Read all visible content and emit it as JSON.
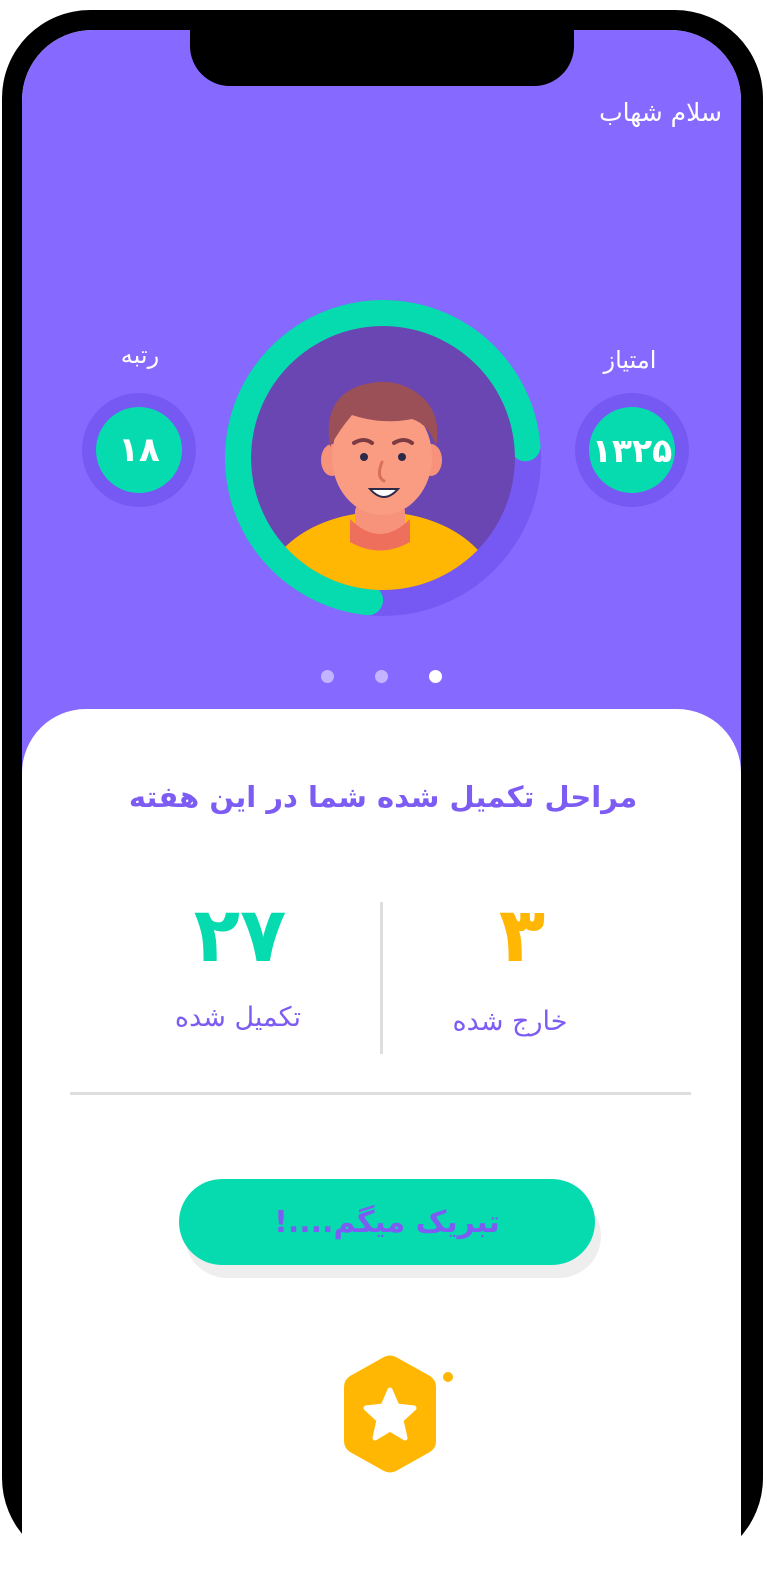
{
  "header": {
    "greeting": "سلام شهاب"
  },
  "stats": {
    "points_label": "امتیاز",
    "points_value": "۱۳۲۵",
    "rank_label": "رتبه",
    "rank_value": "۱۸"
  },
  "avatar": {
    "progress_fraction": 0.72
  },
  "carousel": {
    "page_count": 3,
    "active_index": 2
  },
  "weekly": {
    "title": "مراحل تکمیل شده شما در این هفته",
    "completed_value": "۲۷",
    "completed_label": "تکمیل شده",
    "excluded_value": "۳",
    "excluded_label": "خارج شده"
  },
  "cta": {
    "label": "تبریک میگم....!"
  },
  "colors": {
    "primary_purple": "#8669ff",
    "accent_teal": "#06dbb0",
    "accent_yellow": "#ffb703",
    "text_purple": "#7c5cf2"
  },
  "icons": {
    "badge": "star-hexagon-icon"
  }
}
